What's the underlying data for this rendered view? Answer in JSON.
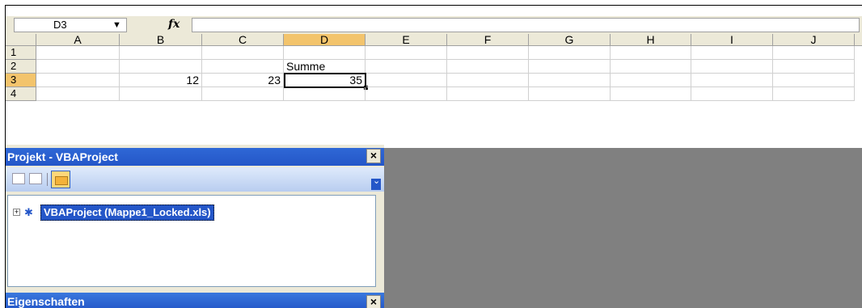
{
  "formula_bar": {
    "name_box": "D3",
    "fx_label": "fx",
    "formula": ""
  },
  "sheet": {
    "columns": [
      "A",
      "B",
      "C",
      "D",
      "E",
      "F",
      "G",
      "H",
      "I",
      "J"
    ],
    "rows": [
      "1",
      "2",
      "3",
      "4"
    ],
    "selected_column": "D",
    "selected_row": "3",
    "cells": {
      "D2": "Summe",
      "B3": "12",
      "C3": "23",
      "D3": "35"
    }
  },
  "project_panel": {
    "title": "Projekt - VBAProject",
    "close": "×",
    "tree_item": "VBAProject (Mappe1_Locked.xls)",
    "tree_expand": "+"
  },
  "properties_panel": {
    "title": "Eigenschaften",
    "close": "×"
  },
  "colors": {
    "selection_header": "#f3c46c",
    "titlebar": "#2456c8",
    "workspace": "#808080"
  }
}
